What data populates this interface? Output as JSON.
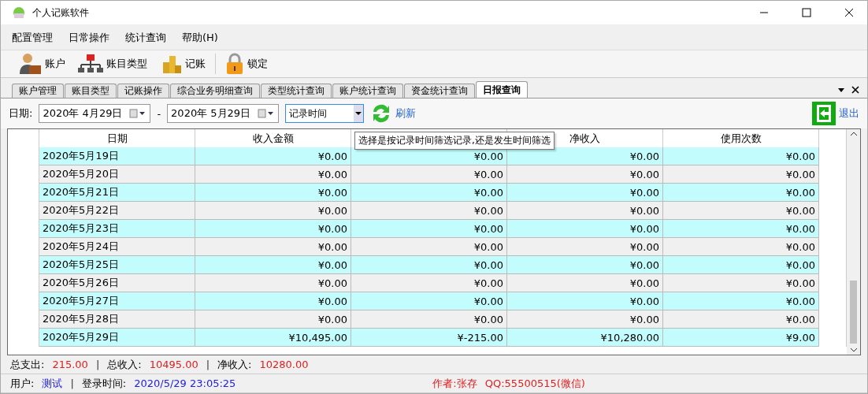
{
  "window": {
    "title": "个人记账软件"
  },
  "menu": [
    "配置管理",
    "日常操作",
    "统计查询",
    "帮助(H)"
  ],
  "toolbar": [
    {
      "kind": "user",
      "label": "账户"
    },
    {
      "kind": "tree",
      "label": "账目类型"
    },
    {
      "kind": "coins",
      "label": "记账"
    },
    {
      "kind": "lock",
      "label": "锁定"
    }
  ],
  "tabs": [
    {
      "label": "账户管理",
      "selected": false
    },
    {
      "label": "账目类型",
      "selected": false
    },
    {
      "label": "记账操作",
      "selected": false
    },
    {
      "label": "综合业务明细查询",
      "selected": false
    },
    {
      "label": "类型统计查询",
      "selected": false
    },
    {
      "label": "账户统计查询",
      "selected": false
    },
    {
      "label": "资金统计查询",
      "selected": false
    },
    {
      "label": "日报查询",
      "selected": true
    }
  ],
  "filter": {
    "label": "日期:",
    "start": "2020年  4月29日",
    "separator": "-",
    "end": "2020年  5月29日",
    "mode": "记录时间",
    "refresh": "刷新",
    "exit": "退出"
  },
  "tooltip": "选择是按记录时间筛选记录,还是发生时间筛选",
  "table": {
    "columns": [
      "日期",
      "收入金额",
      null,
      "净收入",
      "使用次数"
    ],
    "rows": [
      [
        "2020年5月19日",
        "¥0.00",
        "¥0.00",
        "¥0.00",
        "¥0.00"
      ],
      [
        "2020年5月20日",
        "¥0.00",
        "¥0.00",
        "¥0.00",
        "¥0.00"
      ],
      [
        "2020年5月21日",
        "¥0.00",
        "¥0.00",
        "¥0.00",
        "¥0.00"
      ],
      [
        "2020年5月22日",
        "¥0.00",
        "¥0.00",
        "¥0.00",
        "¥0.00"
      ],
      [
        "2020年5月23日",
        "¥0.00",
        "¥0.00",
        "¥0.00",
        "¥0.00"
      ],
      [
        "2020年5月24日",
        "¥0.00",
        "¥0.00",
        "¥0.00",
        "¥0.00"
      ],
      [
        "2020年5月25日",
        "¥0.00",
        "¥0.00",
        "¥0.00",
        "¥0.00"
      ],
      [
        "2020年5月26日",
        "¥0.00",
        "¥0.00",
        "¥0.00",
        "¥0.00"
      ],
      [
        "2020年5月27日",
        "¥0.00",
        "¥0.00",
        "¥0.00",
        "¥0.00"
      ],
      [
        "2020年5月28日",
        "¥0.00",
        "¥0.00",
        "¥0.00",
        "¥0.00"
      ],
      [
        "2020年5月29日",
        "¥10,495.00",
        "¥-215.00",
        "¥10,280.00",
        "¥9.00"
      ]
    ]
  },
  "summary": [
    {
      "label": "总支出:",
      "value": "215.00"
    },
    {
      "separator": "|",
      "label": "总收入:",
      "value": "10495.00"
    },
    {
      "separator": "|",
      "label": "净收入:",
      "value": "10280.00"
    }
  ],
  "status": {
    "user_label": "用户:",
    "user": "测试",
    "separator": "|",
    "login_label": "登录时间:",
    "login_time": "2020/5/29 23:05:25",
    "author": "作者:张存",
    "qq": "QQ:55500515(微信)"
  }
}
